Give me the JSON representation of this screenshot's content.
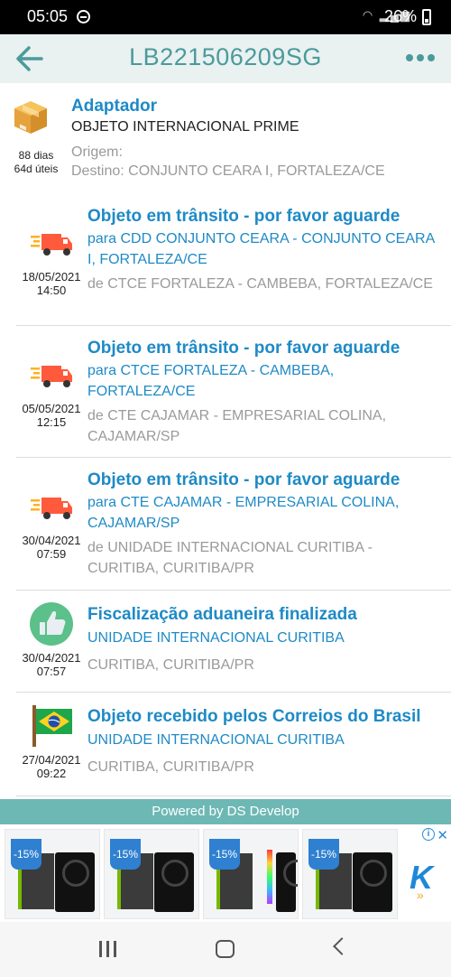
{
  "status_bar": {
    "time": "05:05",
    "battery": "26%"
  },
  "app_bar": {
    "title": "LB221506209SG"
  },
  "package": {
    "name": "Adaptador",
    "type": "OBJETO INTERNACIONAL PRIME",
    "days_total": "88 dias",
    "days_working": "64d úteis",
    "origin": "Origem:",
    "destination": "Destino: CONJUNTO CEARA I, FORTALEZA/CE"
  },
  "events": [
    {
      "icon": "truck-icon",
      "date": "18/05/2021",
      "time": "14:50",
      "status": "Objeto em trânsito - por favor aguarde",
      "location": "para CDD CONJUNTO CEARA - CONJUNTO CEARA I, FORTALEZA/CE",
      "from": "de CTCE FORTALEZA - CAMBEBA, FORTALEZA/CE"
    },
    {
      "icon": "truck-icon",
      "date": "05/05/2021",
      "time": "12:15",
      "status": "Objeto em trânsito - por favor aguarde",
      "location": "para CTCE FORTALEZA - CAMBEBA, FORTALEZA/CE",
      "from": "de CTE CAJAMAR - EMPRESARIAL COLINA, CAJAMAR/SP"
    },
    {
      "icon": "truck-icon",
      "date": "30/04/2021",
      "time": "07:59",
      "status": "Objeto em trânsito - por favor aguarde",
      "location": "para CTE CAJAMAR - EMPRESARIAL COLINA, CAJAMAR/SP",
      "from": "de UNIDADE INTERNACIONAL CURITIBA - CURITIBA, CURITIBA/PR"
    },
    {
      "icon": "thumbs-up-icon",
      "date": "30/04/2021",
      "time": "07:57",
      "status": "Fiscalização aduaneira finalizada",
      "location": "UNIDADE INTERNACIONAL CURITIBA",
      "from": "CURITIBA, CURITIBA/PR"
    },
    {
      "icon": "brazil-flag-icon",
      "date": "27/04/2021",
      "time": "09:22",
      "status": "Objeto recebido pelos Correios do Brasil",
      "location": "UNIDADE INTERNACIONAL CURITIBA",
      "from": "CURITIBA, CURITIBA/PR"
    }
  ],
  "footer": {
    "powered_by": "Powered by DS Develop"
  },
  "ad": {
    "discount": "-15%",
    "cards": [
      "gpu-product-1",
      "gpu-product-2",
      "gpu-product-3",
      "gpu-product-4"
    ]
  },
  "colors": {
    "accent": "#1e8ac6",
    "app_bar_title": "#4c9a9b",
    "footer_bg": "#6db8b5"
  }
}
